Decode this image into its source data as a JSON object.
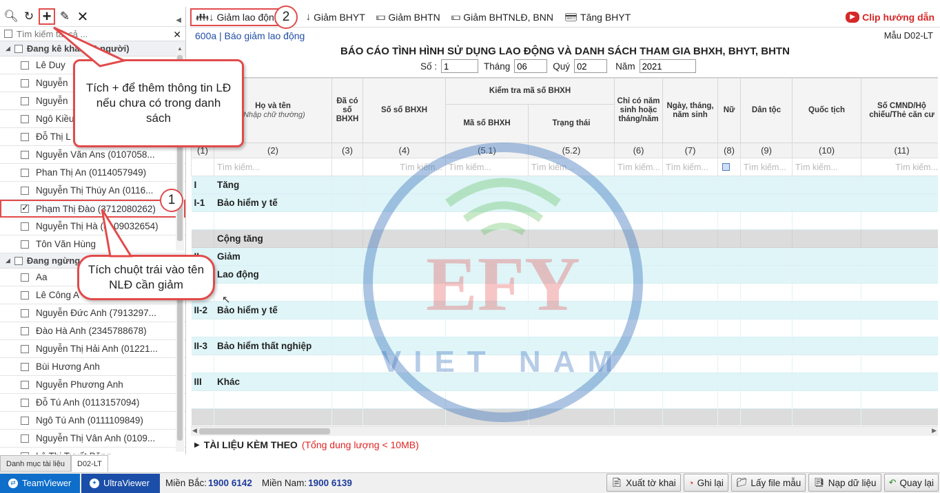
{
  "left": {
    "search_placeholder": "Tìm kiếm tất cả ...",
    "group1": "Đang kê khai (10 người)",
    "group2": "Đang ngừng",
    "group1_items": [
      {
        "name": "Lê Duy"
      },
      {
        "name": "Nguyễn"
      },
      {
        "name": "Nguyễn"
      },
      {
        "name": "Ngô Kiều"
      },
      {
        "name": "Đỗ Thị L"
      },
      {
        "name": "Nguyễn Văn Ans (0107058..."
      },
      {
        "name": "Phan Thị An (0114057949)"
      },
      {
        "name": "Nguyễn Thị Thúy An (0116..."
      },
      {
        "name": "Phạm Thị Đào (3712080262)"
      },
      {
        "name": "Nguyễn Thị Hà (3109032654)"
      },
      {
        "name": "Tôn Văn Hùng"
      }
    ],
    "group2_items": [
      {
        "name": "Aa"
      },
      {
        "name": "Lê Công A"
      },
      {
        "name": "Nguyễn Đức Anh (7913297..."
      },
      {
        "name": "Đào Hà Anh (2345788678)"
      },
      {
        "name": "Nguyễn Thị Hải Anh (01221..."
      },
      {
        "name": "Bùi Hương Anh"
      },
      {
        "name": "Nguyễn Phương Anh"
      },
      {
        "name": "Đỗ Tú Anh (0113157094)"
      },
      {
        "name": "Ngô Tú Anh (0111109849)"
      },
      {
        "name": "Nguyễn Thị Vân Anh (0109..."
      },
      {
        "name": "Lê Thị Tuyết Băng"
      }
    ]
  },
  "bottom_tabs": [
    "Danh mục tài liệu",
    "D02-LT"
  ],
  "toolbar": {
    "items": [
      "Giảm lao động",
      "Giảm BHYT",
      "Giảm BHTN",
      "Giảm BHTNLĐ, BNN",
      "Tăng BHYT"
    ],
    "clip": "Clip hướng dẫn"
  },
  "report": {
    "form_code": "600a | Báo giảm lao động",
    "template": "Mẫu D02-LT",
    "title": "BÁO CÁO TÌNH HÌNH SỬ DỤNG LAO ĐỘNG VÀ DANH SÁCH THAM GIA BHXH, BHYT, BHTN",
    "so_label": "Số :",
    "so_value": "1",
    "thang_label": "Tháng",
    "thang_value": "06",
    "quy_label": "Quý",
    "quy_value": "02",
    "nam_label": "Năm",
    "nam_value": "2021"
  },
  "grid": {
    "headers": {
      "name": "Họ và tên",
      "name_sub": "(Nhập chữ thường)",
      "has_book": "Đã có số BHXH",
      "book_no": "Số sổ BHXH",
      "check_group": "Kiểm tra mã số BHXH",
      "code": "Mã số BHXH",
      "status": "Trạng thái",
      "birth_year_only": "Chỉ có năm sinh hoặc tháng/năm",
      "dob": "Ngày, tháng, năm sinh",
      "female": "Nữ",
      "ethnic": "Dân tộc",
      "nationality": "Quốc tịch",
      "id_card": "Số CMND/Hộ chiếu/Thẻ căn cư"
    },
    "numbers": [
      "(1)",
      "(2)",
      "(3)",
      "(4)",
      "(5.1)",
      "(5.2)",
      "(6)",
      "(7)",
      "(8)",
      "(9)",
      "(10)",
      "(11)"
    ],
    "search_placeholder": "Tìm kiếm...",
    "rows": [
      {
        "code": "I",
        "label": "Tăng",
        "style": "cyan"
      },
      {
        "code": "I-1",
        "label": "Bảo hiểm y tế",
        "style": "cyan"
      },
      {
        "code": "",
        "label": "",
        "style": "white"
      },
      {
        "code": "",
        "label": "Cộng tăng",
        "style": "gray"
      },
      {
        "code": "II",
        "label": "Giảm",
        "style": "cyan"
      },
      {
        "code": "II-1",
        "label": "Lao động",
        "style": "cyan"
      },
      {
        "code": "",
        "label": "",
        "style": "white"
      },
      {
        "code": "II-2",
        "label": "Bảo hiểm y tế",
        "style": "cyan"
      },
      {
        "code": "",
        "label": "",
        "style": "white"
      },
      {
        "code": "II-3",
        "label": "Bảo hiểm thất nghiệp",
        "style": "cyan"
      },
      {
        "code": "",
        "label": "",
        "style": "white"
      },
      {
        "code": "III",
        "label": "Khác",
        "style": "cyan"
      },
      {
        "code": "",
        "label": "",
        "style": "white"
      },
      {
        "code": "",
        "label": "",
        "style": "gray2"
      }
    ]
  },
  "attach": {
    "title": "TÀI LIỆU KÈM THEO",
    "note": "(Tổng dung lượng < 10MB)"
  },
  "callouts": {
    "add": "Tích + để thêm thông tin LĐ nếu chưa có trong danh sách",
    "select": "Tích chuột trái vào tên NLĐ cần giảm",
    "badge1": "1",
    "badge2": "2"
  },
  "watermark": {
    "brand": "EFY",
    "sub": "VIET NAM"
  },
  "statusbar": {
    "teamviewer": "TeamViewer",
    "ultraviewer": "UltraViewer",
    "north_label": "Miền Bắc:",
    "north_phone": "1900 6142",
    "south_label": "Miền Nam:",
    "south_phone": "1900 6139",
    "actions": [
      "Xuất tờ khai",
      "Ghi lại",
      "Lấy file mẫu",
      "Nạp dữ liệu",
      "Quay lại"
    ]
  },
  "colors": {
    "accent": "#e24a4a",
    "header_blue": "#1f4fa6",
    "row_cyan": "#dff5f8"
  }
}
